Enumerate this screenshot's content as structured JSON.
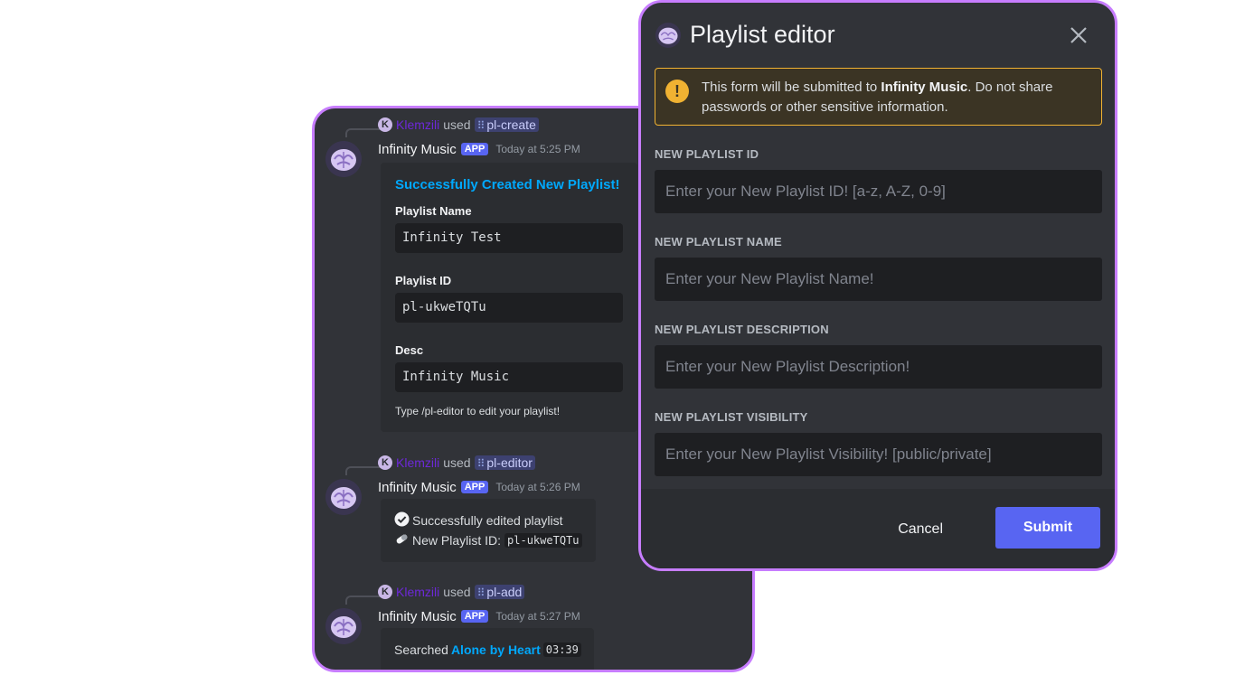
{
  "chat": {
    "messages": [
      {
        "user": "Klemzili",
        "used_text": "used",
        "command": "pl-create",
        "author": "Infinity Music",
        "badge": "APP",
        "time": "Today at 5:25 PM",
        "embed": {
          "title": "Successfully Created New Playlist!",
          "fields": [
            {
              "name": "Playlist Name",
              "value": "Infinity Test"
            },
            {
              "name": "Playlist ID",
              "value": "pl-ukweTQTu"
            },
            {
              "name": "Desc",
              "value": "Infinity Music"
            }
          ],
          "footer": "Type /pl-editor to edit your playlist!"
        }
      },
      {
        "user": "Klemzili",
        "used_text": "used",
        "command": "pl-editor",
        "author": "Infinity Music",
        "badge": "APP",
        "time": "Today at 5:26 PM",
        "line1": "Successfully edited playlist",
        "line2_label": "New Playlist ID:",
        "line2_value": "pl-ukweTQTu"
      },
      {
        "user": "Klemzili",
        "used_text": "used",
        "command": "pl-add",
        "author": "Infinity Music",
        "badge": "APP",
        "time": "Today at 5:27 PM",
        "search_prefix": "Searched",
        "song": "Alone by Heart",
        "duration": "03:39"
      }
    ]
  },
  "modal": {
    "title": "Playlist editor",
    "close_icon": "close-icon",
    "warning": {
      "prefix": "This form will be submitted to ",
      "app": "Infinity Music",
      "suffix": ". Do not share passwords or other sensitive information."
    },
    "fields": [
      {
        "label": "NEW PLAYLIST ID",
        "placeholder": "Enter your New Playlist ID! [a-z, A-Z, 0-9]",
        "value": ""
      },
      {
        "label": "NEW PLAYLIST NAME",
        "placeholder": "Enter your New Playlist Name!",
        "value": ""
      },
      {
        "label": "NEW PLAYLIST DESCRIPTION",
        "placeholder": "Enter your New Playlist Description!",
        "value": ""
      },
      {
        "label": "NEW PLAYLIST VISIBILITY",
        "placeholder": "Enter your New Playlist Visibility! [public/private]",
        "value": ""
      }
    ],
    "cancel_label": "Cancel",
    "submit_label": "Submit"
  },
  "colors": {
    "accent": "#5865f2",
    "link": "#00a8fc",
    "frame_border": "#c77dff",
    "warning": "#f0b232"
  }
}
